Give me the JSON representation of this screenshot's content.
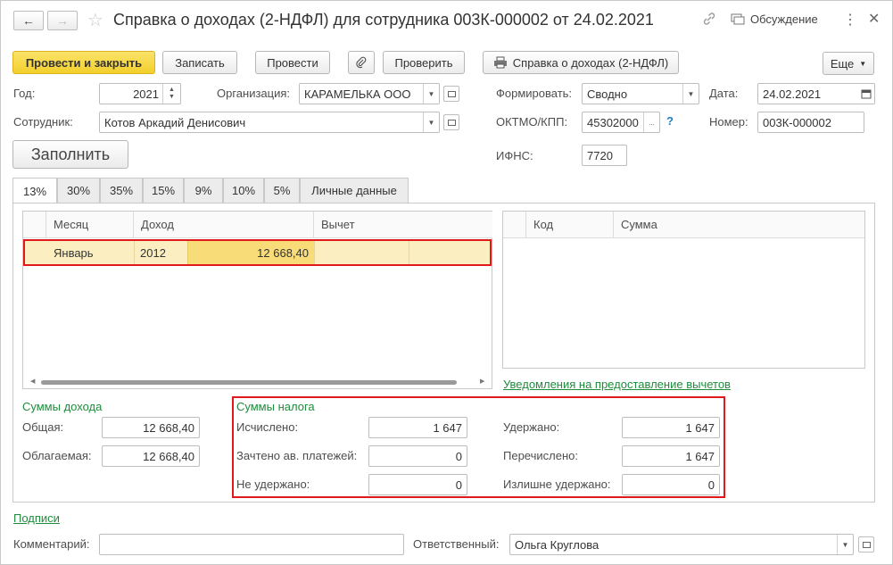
{
  "header": {
    "title": "Справка о доходах (2-НДФЛ) для сотрудника 003К-000002 от 24.02.2021",
    "discussion": "Обсуждение"
  },
  "toolbar": {
    "post_close": "Провести и закрыть",
    "save": "Записать",
    "post": "Провести",
    "check": "Проверить",
    "print_report": "Справка о доходах (2-НДФЛ)",
    "more": "Еще"
  },
  "form": {
    "year_label": "Год:",
    "year_value": "2021",
    "org_label": "Организация:",
    "org_value": "КАРАМЕЛЬКА ООО",
    "form_label": "Формировать:",
    "form_value": "Сводно",
    "date_label": "Дата:",
    "date_value": "24.02.2021",
    "employee_label": "Сотрудник:",
    "employee_value": "Котов Аркадий Денисович",
    "oktmo_label": "ОКТМО/КПП:",
    "oktmo_value": "45302000",
    "oktmo_dots": "...",
    "help": "?",
    "number_label": "Номер:",
    "number_value": "003К-000002",
    "ifns_label": "ИФНС:",
    "ifns_value": "7720",
    "fill_button": "Заполнить"
  },
  "tabs": [
    "13%",
    "30%",
    "35%",
    "15%",
    "9%",
    "10%",
    "5%",
    "Личные данные"
  ],
  "income_table": {
    "columns": [
      "Месяц",
      "Доход",
      "Вычет"
    ],
    "rows": [
      {
        "month": "Январь",
        "code": "2012",
        "amount": "12 668,40"
      }
    ]
  },
  "deduction_table": {
    "columns": [
      "Код",
      "Сумма"
    ]
  },
  "deductions_link": "Уведомления на предоставление вычетов",
  "income_sums": {
    "title": "Суммы дохода",
    "total_label": "Общая:",
    "total_value": "12 668,40",
    "taxable_label": "Облагаемая:",
    "taxable_value": "12 668,40"
  },
  "tax_sums": {
    "title": "Суммы налога",
    "calculated_label": "Исчислено:",
    "calculated_value": "1 647",
    "credited_label": "Зачтено ав. платежей:",
    "credited_value": "0",
    "not_withheld_label": "Не удержано:",
    "not_withheld_value": "0",
    "withheld_label": "Удержано:",
    "withheld_value": "1 647",
    "transferred_label": "Перечислено:",
    "transferred_value": "1 647",
    "over_withheld_label": "Излишне удержано:",
    "over_withheld_value": "0"
  },
  "footer": {
    "signatures_link": "Подписи",
    "comment_label": "Комментарий:",
    "comment_value": "",
    "responsible_label": "Ответственный:",
    "responsible_value": "Ольга Круглова"
  },
  "colors": {
    "accent_yellow": "#f3cf2c",
    "selection_row": "#fbeec0",
    "highlight_frame": "#e01a1a",
    "link_green": "#1f8c3c"
  }
}
